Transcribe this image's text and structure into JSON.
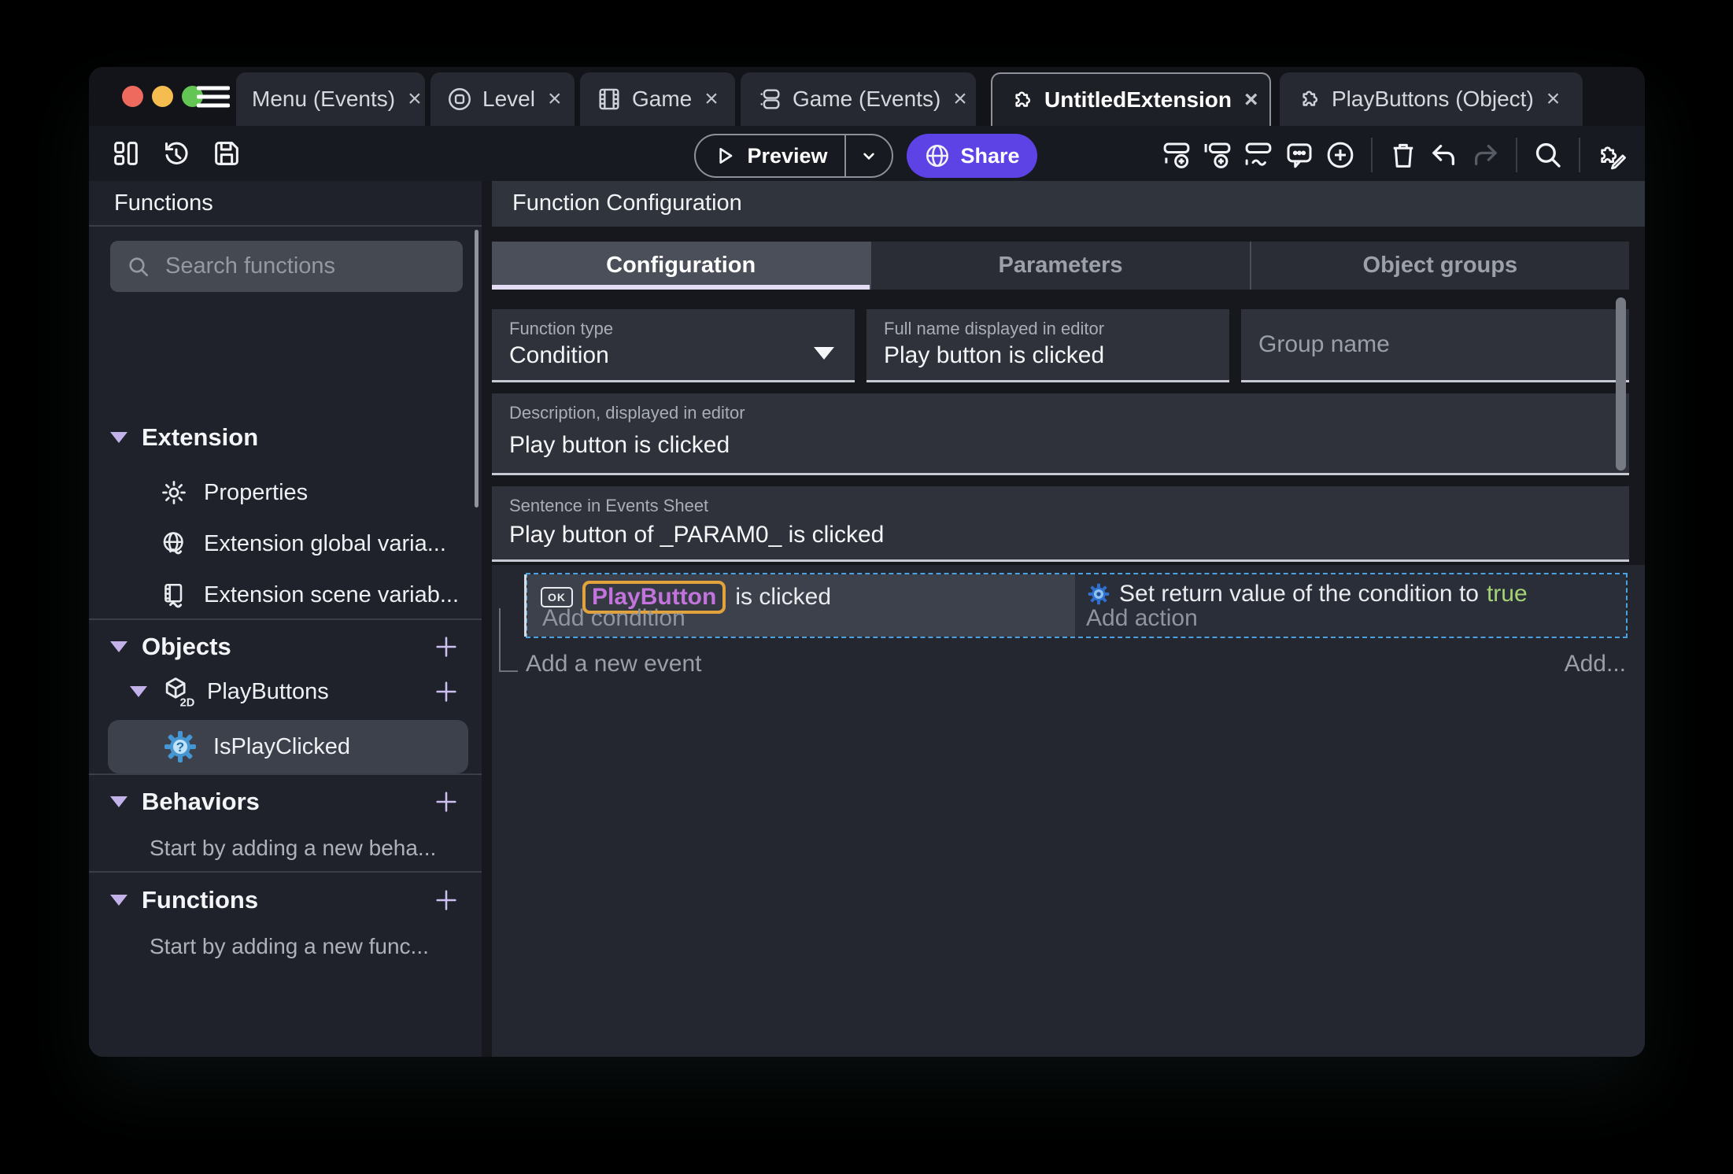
{
  "colors": {
    "accent_purple": "#5d43e6",
    "selection_border": "#4aa2e2",
    "object_highlight_border": "#e3a33c",
    "object_text": "#c273dc",
    "true_value_green": "#a5d376"
  },
  "tabbar": {
    "close_glyph": "×",
    "tabs": [
      {
        "label": "Menu (Events)"
      },
      {
        "label": "Level"
      },
      {
        "label": "Game"
      },
      {
        "label": "Game (Events)"
      },
      {
        "label": "UntitledExtension"
      },
      {
        "label": "PlayButtons (Object)"
      }
    ]
  },
  "toolbar": {
    "preview_label": "Preview",
    "share_label": "Share"
  },
  "sidebar": {
    "title": "Functions",
    "search_placeholder": "Search functions",
    "extension_header": "Extension",
    "items": [
      {
        "label": "Properties"
      },
      {
        "label": "Extension global varia..."
      },
      {
        "label": "Extension scene variab..."
      }
    ],
    "objects_header": "Objects",
    "object_item": "PlayButtons",
    "selected_function": "IsPlayClicked",
    "behaviors_header": "Behaviors",
    "behaviors_empty": "Start by adding a new beha...",
    "functions_header": "Functions",
    "functions_empty": "Start by adding a new func..."
  },
  "main": {
    "title": "Function Configuration",
    "tabs": [
      {
        "label": "Configuration"
      },
      {
        "label": "Parameters"
      },
      {
        "label": "Object groups"
      }
    ],
    "fields": {
      "function_type": {
        "label": "Function type",
        "value": "Condition"
      },
      "full_name": {
        "label": "Full name displayed in editor",
        "value": "Play button is clicked"
      },
      "group_name": {
        "placeholder": "Group name"
      },
      "description": {
        "label": "Description, displayed in editor",
        "value": "Play button is clicked"
      },
      "sentence": {
        "label": "Sentence in Events Sheet",
        "value": "Play button of _PARAM0_ is clicked"
      }
    },
    "events": {
      "ok_badge": "OK",
      "condition_object": "PlayButton",
      "condition_suffix": "is clicked",
      "add_condition": "Add condition",
      "action_prefix": "Set return value of the condition to",
      "action_value": "true",
      "add_action": "Add action",
      "add_new_event": "Add a new event",
      "add_more": "Add..."
    }
  }
}
